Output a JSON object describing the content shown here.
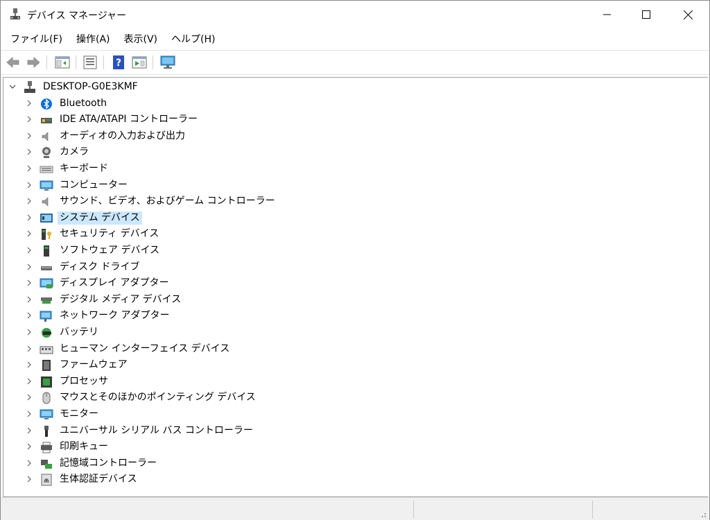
{
  "window": {
    "title": "デバイス マネージャー"
  },
  "menu": {
    "file": "ファイル(F)",
    "action": "操作(A)",
    "view": "表示(V)",
    "help": "ヘルプ(H)"
  },
  "toolbar": {
    "icons": [
      "back-icon",
      "forward-icon",
      "show-hide-tree-icon",
      "properties-icon",
      "help-icon",
      "run-icon",
      "scan-hardware-icon"
    ]
  },
  "tree": {
    "root": "DESKTOP-G0E3KMF",
    "selected": "システム デバイス",
    "categories": [
      "Bluetooth",
      "IDE ATA/ATAPI コントローラー",
      "オーディオの入力および出力",
      "カメラ",
      "キーボード",
      "コンピューター",
      "サウンド、ビデオ、およびゲーム コントローラー",
      "システム デバイス",
      "セキュリティ デバイス",
      "ソフトウェア デバイス",
      "ディスク ドライブ",
      "ディスプレイ アダプター",
      "デジタル メディア デバイス",
      "ネットワーク アダプター",
      "バッテリ",
      "ヒューマン インターフェイス デバイス",
      "ファームウェア",
      "プロセッサ",
      "マウスとそのほかのポインティング デバイス",
      "モニター",
      "ユニバーサル シリアル バス コントローラー",
      "印刷キュー",
      "記憶域コントローラー",
      "生体認証デバイス"
    ]
  },
  "colors": {
    "selection": "#cce8ff",
    "bluetooth": "#0a6fd8",
    "monitor": "#3a9bdc"
  }
}
